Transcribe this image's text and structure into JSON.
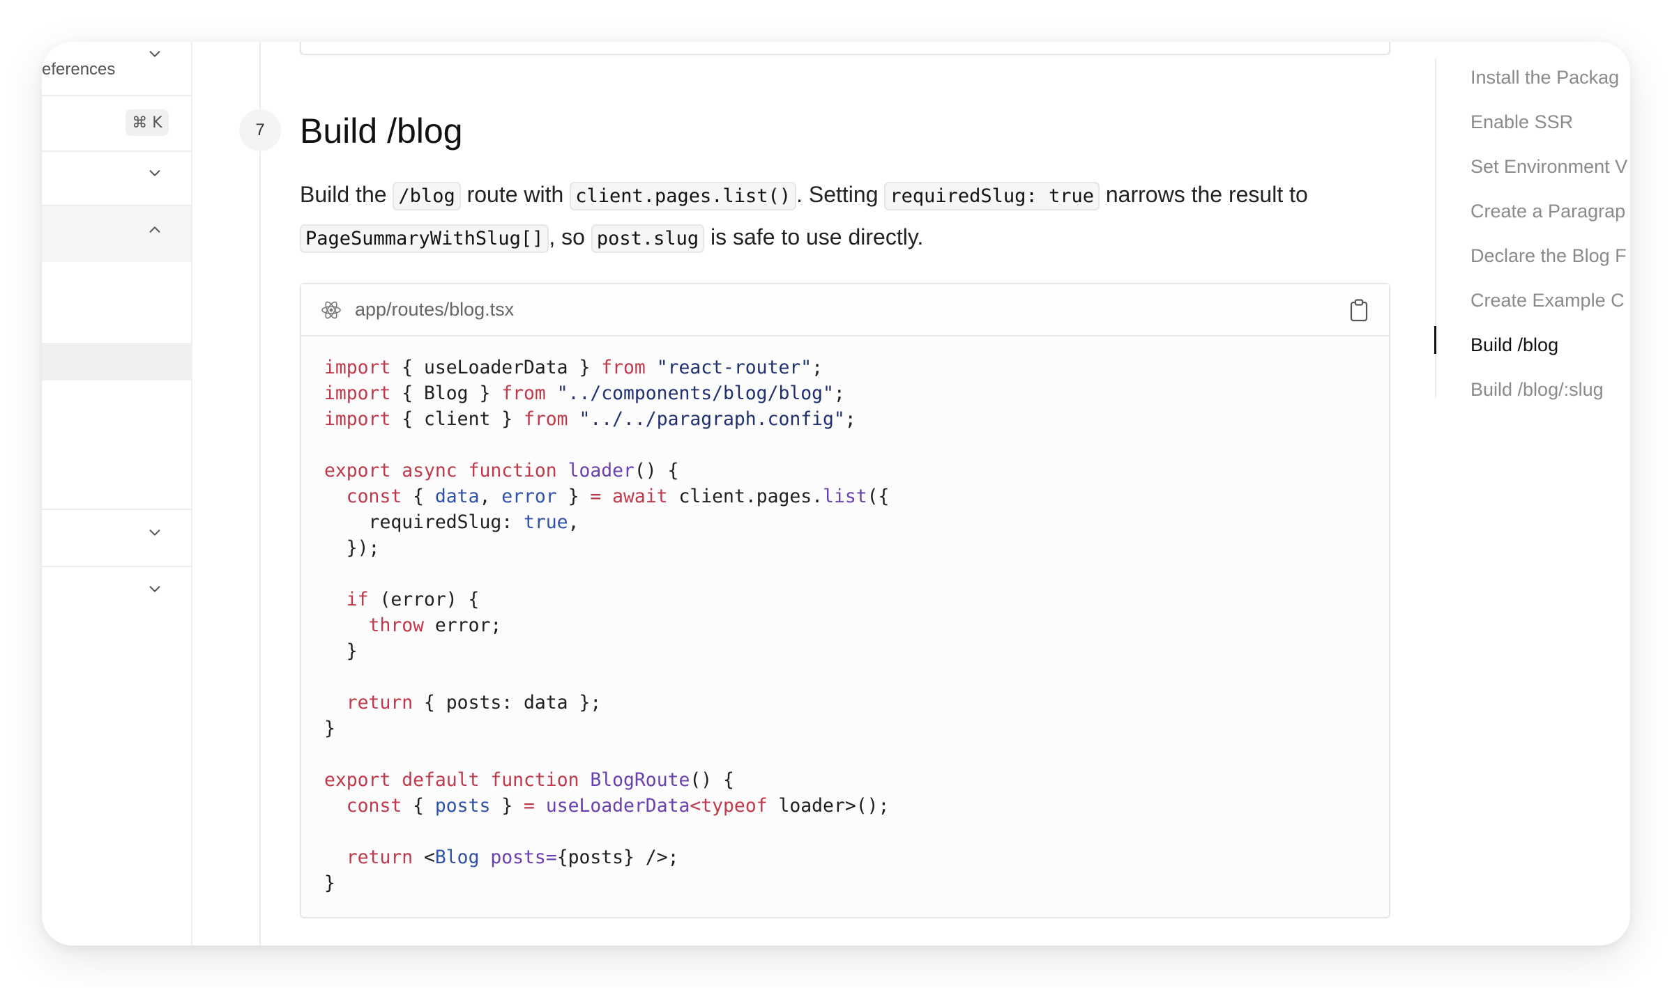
{
  "sidebar": {
    "partial_label": "eferences",
    "shortcut": "⌘ K"
  },
  "step": {
    "number": "7",
    "title": "Build /blog"
  },
  "paragraph": {
    "t1": "Build the ",
    "c1": "/blog",
    "t2": " route with ",
    "c2": "client.pages.list()",
    "t3": ". Setting ",
    "c3": "requiredSlug: true",
    "t4": " narrows the result to ",
    "c4": "PageSummaryWithSlug[]",
    "t5": ", so ",
    "c5": "post.slug",
    "t6": " is safe to use directly."
  },
  "code_block": {
    "filename": "app/routes/blog.tsx",
    "language": "tsx",
    "icon": "react-icon",
    "copy_icon": "clipboard-icon",
    "lines": [
      "import { useLoaderData } from \"react-router\";",
      "import { Blog } from \"../components/blog/blog\";",
      "import { client } from \"../../paragraph.config\";",
      "",
      "export async function loader() {",
      "  const { data, error } = await client.pages.list({",
      "    requiredSlug: true,",
      "  });",
      "",
      "  if (error) {",
      "    throw error;",
      "  }",
      "",
      "  return { posts: data };",
      "}",
      "",
      "export default function BlogRoute() {",
      "  const { posts } = useLoaderData<typeof loader>();",
      "",
      "  return <Blog posts={posts} />;",
      "}"
    ]
  },
  "toc": {
    "items": [
      "Install the Packag",
      "Enable SSR",
      "Set Environment V",
      "Create a Paragrap",
      "Declare the Blog F",
      "Create Example C",
      "Build /blog",
      "Build /blog/:slug"
    ],
    "active": "Build /blog"
  }
}
